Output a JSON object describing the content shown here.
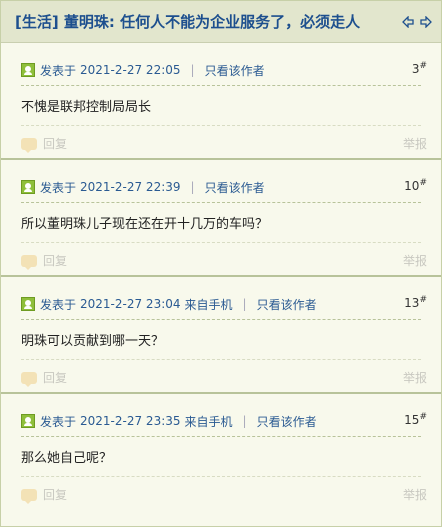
{
  "header": {
    "title": "[生活] 董明珠: 任何人不能为企业服务了，必须走人"
  },
  "posts": [
    {
      "posted_label": "发表于",
      "date": "2021-2-27 22:05",
      "source": "",
      "only_author": "只看该作者",
      "floor": "3",
      "floor_suffix": "#",
      "body": "不愧是联邦控制局局长",
      "reply": "回复",
      "report": "举报"
    },
    {
      "posted_label": "发表于",
      "date": "2021-2-27 22:39",
      "source": "",
      "only_author": "只看该作者",
      "floor": "10",
      "floor_suffix": "#",
      "body": "所以董明珠儿子现在还在开十几万的车吗？",
      "reply": "回复",
      "report": "举报"
    },
    {
      "posted_label": "发表于",
      "date": "2021-2-27 23:04",
      "source": "来自手机",
      "only_author": "只看该作者",
      "floor": "13",
      "floor_suffix": "#",
      "body": "明珠可以贡献到哪一天？",
      "reply": "回复",
      "report": "举报"
    },
    {
      "posted_label": "发表于",
      "date": "2021-2-27 23:35",
      "source": "来自手机",
      "only_author": "只看该作者",
      "floor": "15",
      "floor_suffix": "#",
      "body": "那么她自己呢？",
      "reply": "回复",
      "report": "举报"
    }
  ],
  "colors": {
    "header_bg": "#e2e6cd",
    "title": "#1d4f8e",
    "link": "#2a5a92",
    "page_bg": "#f8f9ec",
    "muted": "#c8c8c0"
  }
}
